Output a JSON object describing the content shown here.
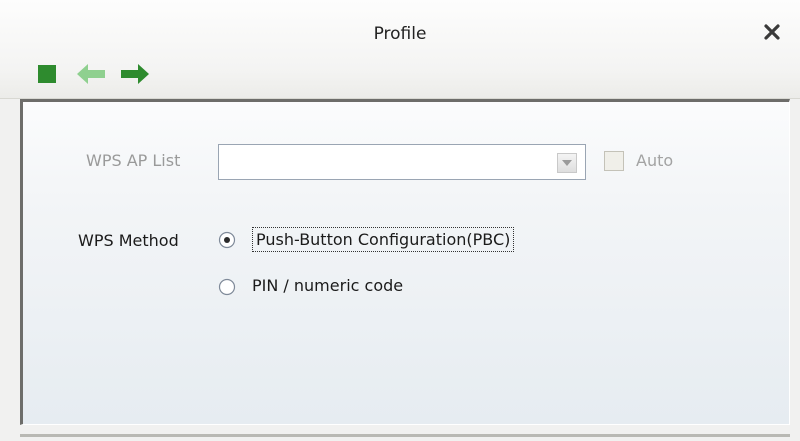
{
  "window": {
    "title": "Profile"
  },
  "toolbar": {
    "buttons": [
      {
        "icon": "stop-square-icon",
        "color": "#2e8b2e"
      },
      {
        "icon": "back-arrow-icon",
        "color": "#8fd08f"
      },
      {
        "icon": "forward-arrow-icon",
        "color": "#2e8b2e"
      }
    ]
  },
  "form": {
    "ap_list_label": "WPS AP List",
    "ap_list_value": "",
    "auto_label": "Auto",
    "auto_checked": false,
    "method_label": "WPS Method",
    "methods": [
      {
        "label": "Push-Button Configuration(PBC)",
        "selected": true
      },
      {
        "label": "PIN / numeric code",
        "selected": false
      }
    ]
  },
  "colors": {
    "icon_green": "#2e8b2e",
    "icon_green_disabled": "#8fd08f",
    "disabled_text": "#9a9a9a"
  }
}
